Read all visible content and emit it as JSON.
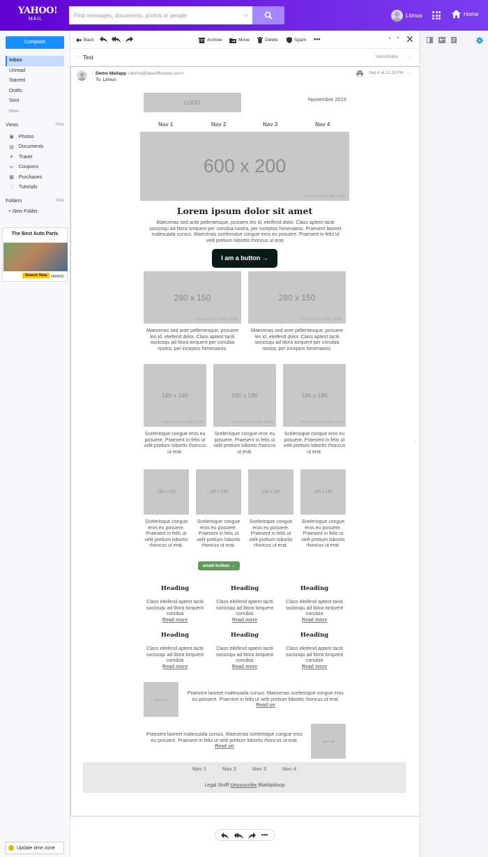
{
  "header": {
    "logo": "YAHOO!",
    "logo_sub": "MAIL",
    "search_placeholder": "Find messages, documents, photos or people",
    "user_name": "Litmus",
    "home_label": "Home"
  },
  "sidebar": {
    "compose": "Compose",
    "folders": [
      "Inbox",
      "Unread",
      "Starred",
      "Drafts",
      "Sent"
    ],
    "more": "More",
    "views_title": "Views",
    "views_hide": "Hide",
    "views": [
      {
        "label": "Photos",
        "icon": "photos-icon"
      },
      {
        "label": "Documents",
        "icon": "documents-icon"
      },
      {
        "label": "Travel",
        "icon": "travel-icon"
      },
      {
        "label": "Coupons",
        "icon": "coupons-icon"
      },
      {
        "label": "Purchases",
        "icon": "purchases-icon"
      },
      {
        "label": "Tutorials",
        "icon": "tutorials-icon"
      }
    ],
    "folders_title": "Folders",
    "folders_hide": "Hide",
    "new_folder": "+ New Folder",
    "ad": {
      "title": "The Best Auto Parts",
      "cta": "Search Now",
      "brand": "YAHOO!"
    },
    "timezone": "Update time zone"
  },
  "toolbar": {
    "back": "Back",
    "archive": "Archive",
    "move": "Move",
    "delete": "Delete",
    "spam": "Spam"
  },
  "message": {
    "subject": "Test",
    "folder_path": "Yahoo/Inbox",
    "sender_name": "Demo Mailapp",
    "sender_email": "<demo@takeoffmedia.com>",
    "to": "To: Litmus",
    "date": "Sep 4 at 12:18 PM"
  },
  "email": {
    "logo": "LOGO",
    "date": "Noviembre 2015",
    "nav": [
      "Nav 1",
      "Nav 2",
      "Nav 3",
      "Nav 4"
    ],
    "hero": "600 x 200",
    "powered": "Powered by HTML.COM",
    "title": "Lorem ipsum dolor sit amet",
    "intro": "Maecenas sed ante pellentesque, posuere leo id, eleifend dolor. Class aptent taciti sociosqu ad litora torquent per conubia nostra, per inceptos himenaeos. Praesent laoreet malesuada cursus. Maecenas scelerisque congue eros eu posuere. Praesent in felis ut velit pretium lobortis rhoncus ut erat.",
    "button": "I am a button →",
    "two_col": {
      "image": "280 x 150",
      "text": "Maecenas sed ante pellentesque, posuere leo id, eleifend dolor. Class aptent taciti sociosqu ad litora torquent per conubia nostra, per inceptos himenaeos."
    },
    "three_col": {
      "image": "180 x 180",
      "text": "Scelerisque congue eros eu posuere. Praesent in felis ut velit pretium lobortis rhoncus ut erat."
    },
    "four_col": {
      "image": "130 x 130",
      "text": "Scelerisque congue eros eu posuere. Praesent in felis ut velit pretium lobortis rhoncus ut erat."
    },
    "small_button": "small-button →",
    "heading": "Heading",
    "heading_text": "Class eleifend aptent taciti sociosqu ad litora torquent conubia",
    "read_more": "Read more",
    "media_thumb": "100 x 100",
    "media_text": "Praesent laoreet malesuada cursus. Maecenas scelerisque congue eros eu posuere. Praesent in felis ut velit pretium lobortis rhoncus ut erat.",
    "read_on": "Read on",
    "footer_nav": [
      "Nav 1",
      "Nav 2",
      "Nav 3",
      "Nav 4"
    ],
    "legal_prefix": "Legal Stufff",
    "unsubscribe": "Unsuscribe",
    "legal_suffix": "Blablipbloop"
  },
  "colors": {
    "header": "#6001d2",
    "compose": "#188fff",
    "dark_button": "#0a1a17",
    "small_button": "#5e9c5a",
    "placeholder": "#c8c8c8"
  }
}
